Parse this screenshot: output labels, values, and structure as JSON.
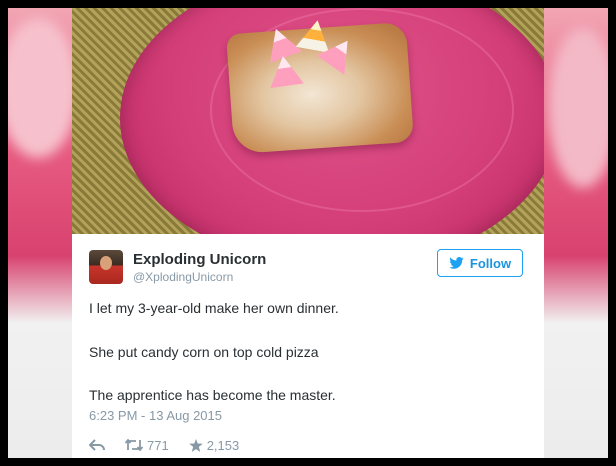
{
  "tweet": {
    "author_name": "Exploding Unicorn",
    "author_handle": "@XplodingUnicorn",
    "follow_label": "Follow",
    "lines": [
      "I let my 3-year-old make her own dinner.",
      "She put candy corn on top cold pizza",
      "The apprentice has become the master."
    ],
    "timestamp": "6:23 PM - 13 Aug 2015",
    "retweets": "771",
    "likes": "2,153"
  },
  "icons": [
    "twitter-bird-icon",
    "reply-icon",
    "retweet-icon",
    "star-icon"
  ],
  "colors": {
    "accent": "#1da1f2",
    "text": "#292f33",
    "muted": "#8899a6",
    "plate": "#d43e78"
  }
}
